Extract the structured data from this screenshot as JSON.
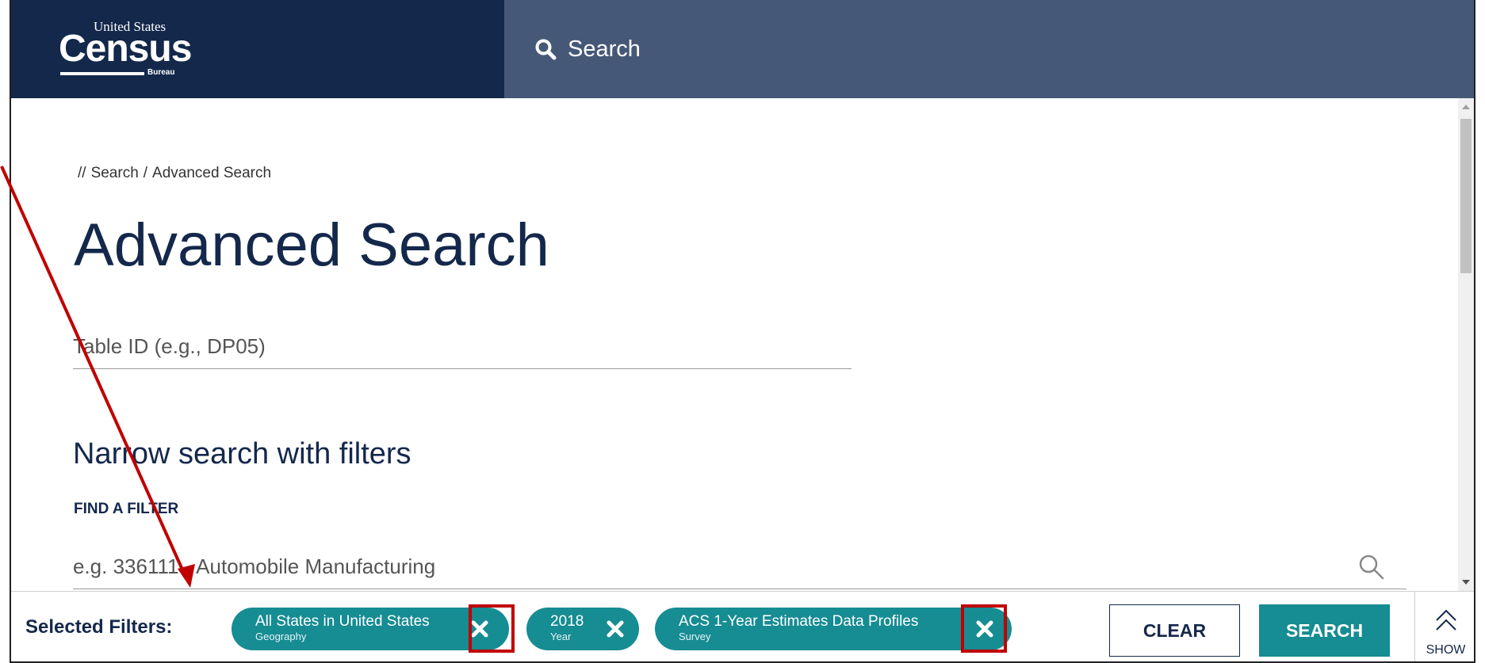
{
  "header": {
    "logo": {
      "top": "United States",
      "name": "Census",
      "bottom": "Bureau"
    },
    "search_label": "Search"
  },
  "breadcrumb": {
    "prefix": "//",
    "items": [
      "Search",
      "Advanced Search"
    ],
    "separator": "/"
  },
  "page_title": "Advanced Search",
  "table_id": {
    "placeholder": "Table ID (e.g., DP05)",
    "value": ""
  },
  "filters_section": {
    "heading": "Narrow search with filters",
    "find_label": "FIND A FILTER",
    "placeholder": "e.g. 336111 - Automobile Manufacturing"
  },
  "filter_bar": {
    "label": "Selected Filters:",
    "chips": [
      {
        "value": "All States in United States",
        "category": "Geography",
        "highlighted": true
      },
      {
        "value": "2018",
        "category": "Year",
        "highlighted": false
      },
      {
        "value": "ACS 1-Year Estimates Data Profiles",
        "category": "Survey",
        "highlighted": true
      }
    ],
    "clear_label": "CLEAR",
    "search_label": "SEARCH",
    "show_label": "SHOW"
  },
  "colors": {
    "navy": "#14284b",
    "header_search_bg": "#465877",
    "teal": "#168c93",
    "annotation_red": "#c00000"
  },
  "icons": [
    "search-icon",
    "magnifier-icon",
    "close-icon",
    "chevron-double-up-icon"
  ]
}
